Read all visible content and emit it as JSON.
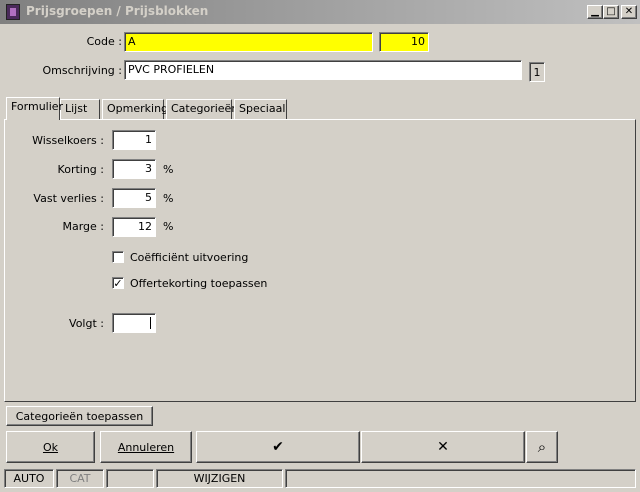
{
  "window": {
    "title": "Prijsgroepen / Prijsblokken",
    "min": "▁",
    "max": "□",
    "close": "✕"
  },
  "header": {
    "code_label": "Code :",
    "code_value": "A",
    "code_number": "10",
    "omschrijving_label": "Omschrijving :",
    "omschrijving_value": "PVC PROFIELEN",
    "badge": "1"
  },
  "tabs": [
    {
      "label": "Formulier",
      "active": true
    },
    {
      "label": "Lijst"
    },
    {
      "label": "Opmerking"
    },
    {
      "label": "Categorieën"
    },
    {
      "label": "Speciaal"
    }
  ],
  "form": {
    "wisselkoers": {
      "label": "Wisselkoers :",
      "value": "1"
    },
    "korting": {
      "label": "Korting :",
      "value": "3",
      "unit": "%"
    },
    "vast_verlies": {
      "label": "Vast verlies :",
      "value": "5",
      "unit": "%"
    },
    "marge": {
      "label": "Marge :",
      "value": "12",
      "unit": "%"
    },
    "coefficient": {
      "label": "Coëfficiënt uitvoering",
      "checked": false
    },
    "offertekorting": {
      "label": "Offertekorting toepassen",
      "checked": true,
      "mark": "✓"
    },
    "volgt": {
      "label": "Volgt :",
      "value": ""
    }
  },
  "buttons": {
    "categorieen": "Categorieën toepassen",
    "ok": "Ok",
    "annuleren": "Annuleren",
    "check": "✔",
    "cross": "✕",
    "binoculars": "⌕"
  },
  "statusbar": [
    "AUTO",
    "CAT",
    "",
    "WIJZIGEN",
    ""
  ]
}
